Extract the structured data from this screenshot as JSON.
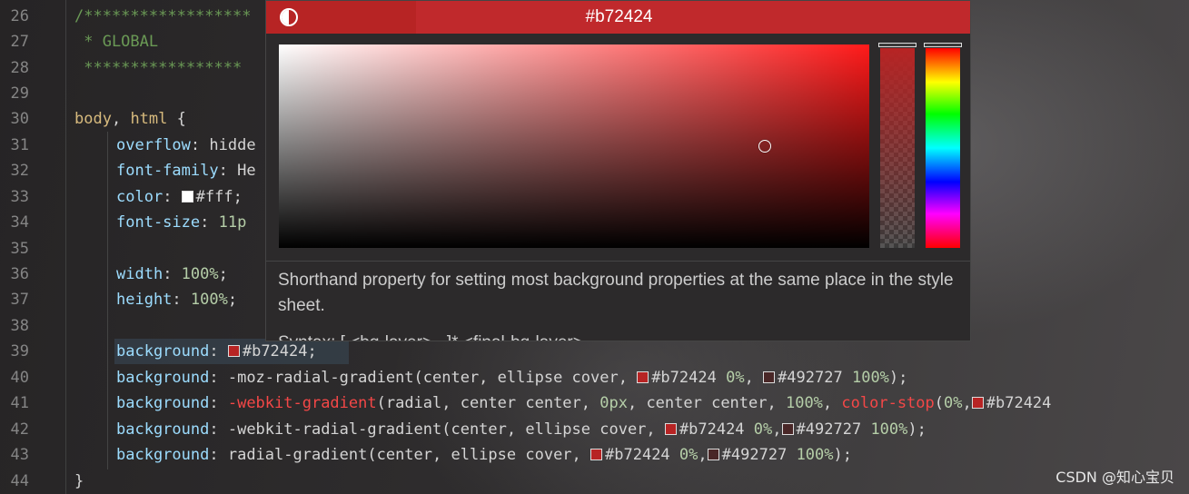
{
  "editor": {
    "line_numbers": [
      "26",
      "27",
      "28",
      "29",
      "30",
      "31",
      "32",
      "33",
      "34",
      "35",
      "36",
      "37",
      "38",
      "39",
      "40",
      "41",
      "42",
      "43",
      "44"
    ],
    "lines": {
      "l26": "/******************",
      "l27": " * GLOBAL",
      "l28": " *****************",
      "l30_sel": "body",
      "l30_sep": ", ",
      "l30_sel2": "html",
      "l30_brace": " {",
      "l31_prop": "overflow",
      "l31_val": "hidde",
      "l32_prop": "font-family",
      "l32_val": "He",
      "l33_prop": "color",
      "l33_val": "#fff;",
      "l34_prop": "font-size",
      "l34_val": "11p",
      "l36_prop": "width",
      "l36_val": "100%",
      "l37_prop": "height",
      "l37_val": "100%",
      "l39_prop": "background",
      "l39_val": "#b72424",
      "l40_prop": "background",
      "l40_fn": "-moz-radial-gradient(center, ellipse cover, ",
      "l40_c1": "#b72424",
      "l40_p1": "0%",
      "l40_c2": "#492727",
      "l40_p2": "100%",
      "l41_prop": "background",
      "l41_fn": "-webkit-gradient",
      "l41_args": "(radial, center center, ",
      "l41_n1": "0px",
      "l41_args2": ", center center, ",
      "l41_n2": "100%",
      "l41_fn2": "color-stop",
      "l41_n3": "0%",
      "l41_c1": "#b72424",
      "l42_prop": "background",
      "l42_fn": "-webkit-radial-gradient(center, ellipse cover, ",
      "l42_c1": "#b72424",
      "l42_p1": "0%",
      "l42_c2": "#492727",
      "l42_p2": "100%",
      "l43_prop": "background",
      "l43_fn": "radial-gradient(center, ellipse cover, ",
      "l43_c1": "#b72424",
      "l43_p1": "0%",
      "l43_c2": "#492727",
      "l43_p2": "100%",
      "l44": "}"
    }
  },
  "color_picker": {
    "hex_value": "#b72424",
    "original_color": "#b72424",
    "current_color": "#c0292c",
    "contrast_icon": "contrast-icon",
    "description": "Shorthand property for setting most background properties at the same place in the style sheet.",
    "syntax_partial": "Syntax: [ <bg-layer> , ]* <final-bg-layer>"
  },
  "colors": {
    "swatch_red": "#b72424",
    "swatch_dark": "#492727",
    "swatch_white": "#ffffff"
  },
  "watermark": "CSDN @知心宝贝"
}
